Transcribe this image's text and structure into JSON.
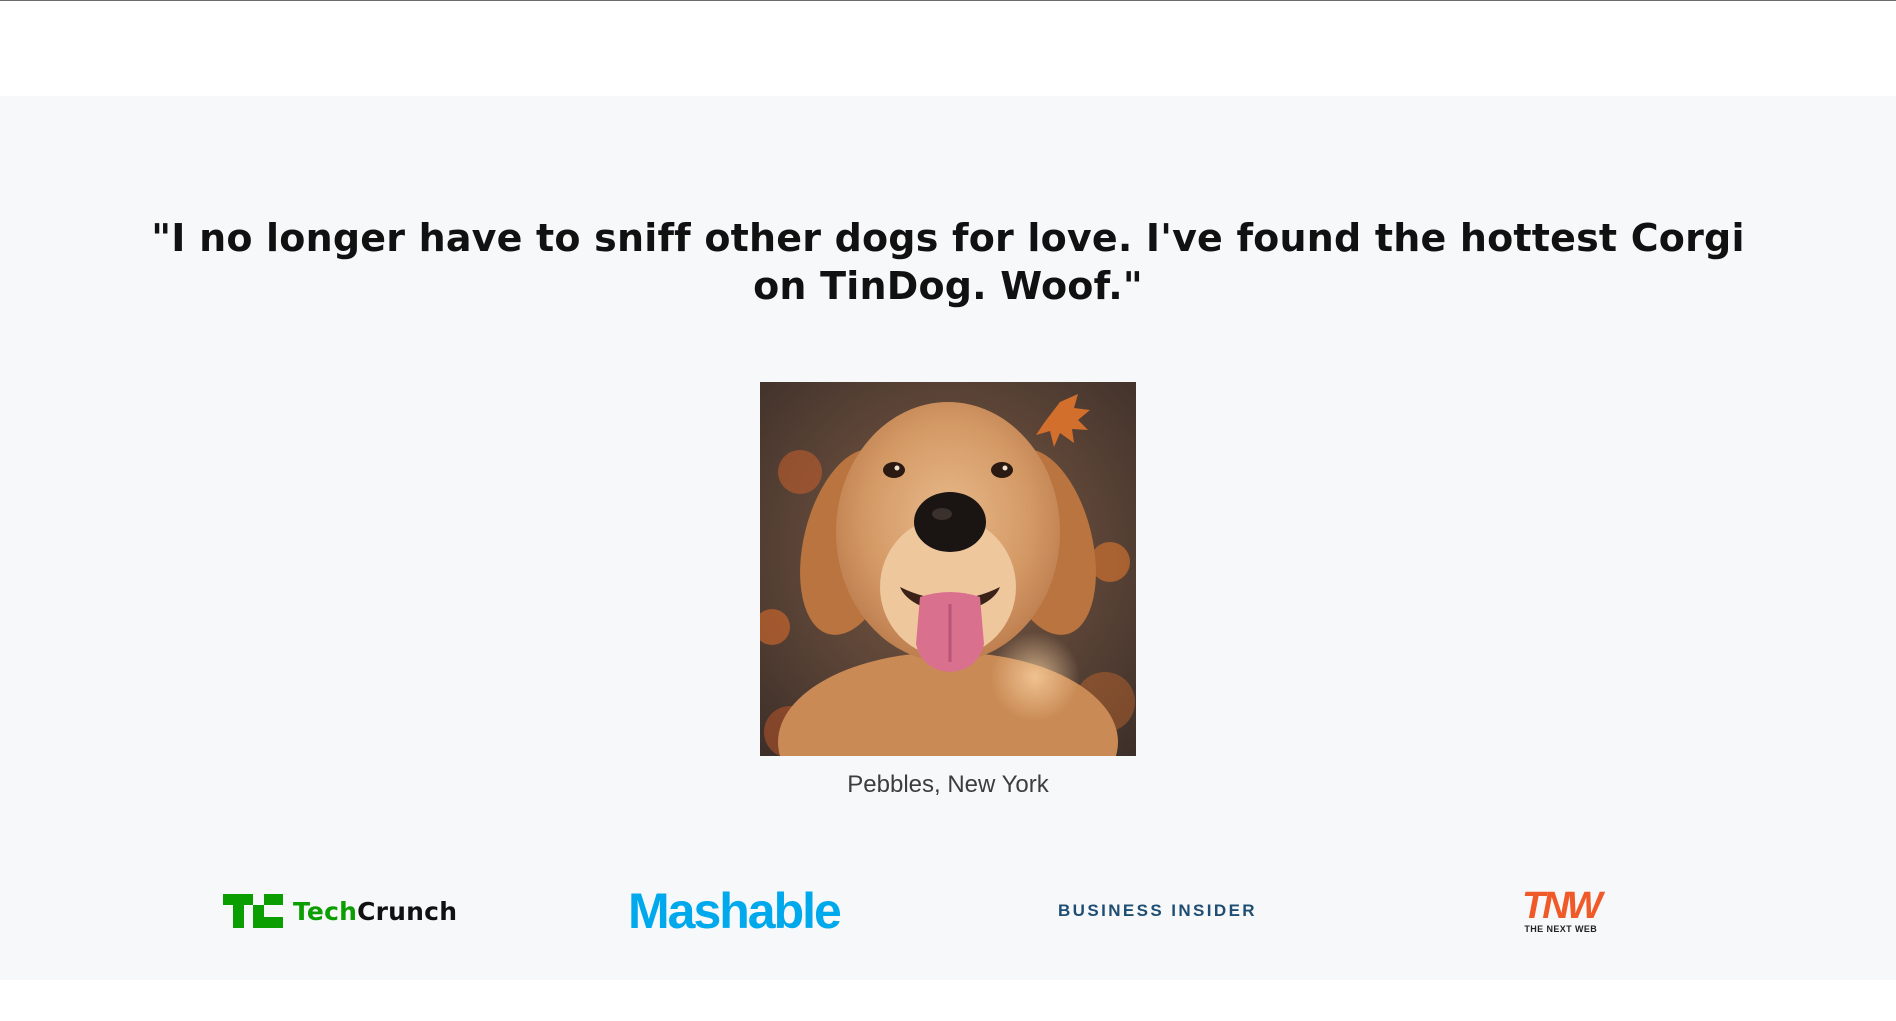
{
  "testimonial": {
    "quote": "\"I no longer have to sniff other dogs for love. I've found the hottest Corgi on TinDog. Woof.\"",
    "image_alt": "golden retriever dog",
    "caption": "Pebbles, New York"
  },
  "press": {
    "logos": [
      {
        "name": "TechCrunch",
        "part_a": "Tech",
        "part_b": "Crunch",
        "color": "#0a9e01"
      },
      {
        "name": "Mashable",
        "text": "Mashable",
        "color": "#00a8ec"
      },
      {
        "name": "Business Insider",
        "text": "BUSINESS INSIDER",
        "color": "#1f4e72"
      },
      {
        "name": "TNW",
        "mark": "TNW",
        "subtitle": "THE NEXT WEB",
        "color": "#f05a28"
      }
    ]
  },
  "colors": {
    "section_background": "#f7f8fa",
    "quote_text": "#111111",
    "caption_text": "#3d3d3d"
  }
}
